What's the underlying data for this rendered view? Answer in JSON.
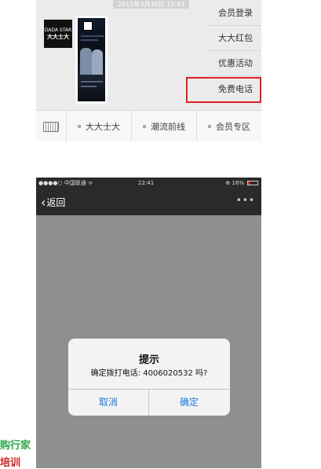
{
  "top_screenshot": {
    "timestamp": "2015年3月30日 12:43",
    "avatar": {
      "line1": "DADA STAR",
      "line2": "大大士大"
    },
    "menu_items": [
      "会员登录",
      "大大红包",
      "优惠活动",
      "免费电话"
    ],
    "highlighted_item": "免费电话",
    "highlight_color": "#e12121",
    "bottom_menu": {
      "keyboard_icon": "keyboard-icon",
      "tabs": [
        "大大士大",
        "潮流前线",
        "会员专区"
      ]
    }
  },
  "bottom_screenshot": {
    "status_bar": {
      "carrier": "●●●●○ 中国联通 ᯤ",
      "time": "22:41",
      "battery": "⊕ 16%"
    },
    "nav": {
      "back_label": "返回",
      "more_label": "•••"
    },
    "alert": {
      "title": "提示",
      "message": "确定拨打电话: 4006020532 吗?",
      "cancel": "取消",
      "confirm": "确定",
      "button_color": "#1679e0"
    }
  },
  "cropped_text": {
    "line1": "购行家",
    "line2": "培训"
  }
}
